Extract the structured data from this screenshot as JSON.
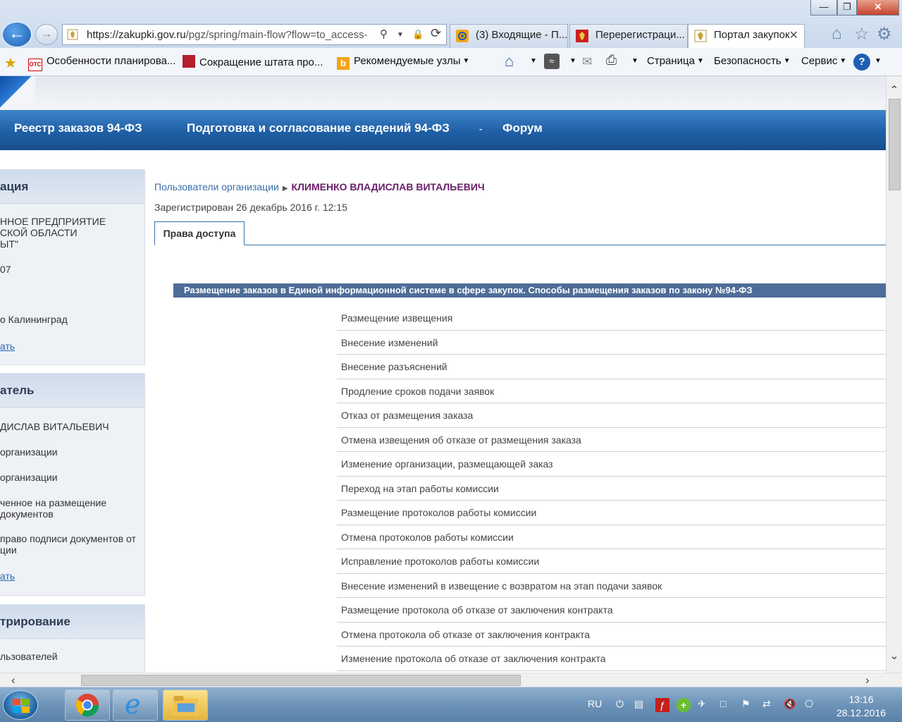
{
  "browser": {
    "window_controls": {
      "minimize": "—",
      "restore": "❐",
      "close": "✕"
    },
    "address": {
      "url_host": "https://zakupki.gov.ru",
      "url_path": "/pgz/spring/main-flow?flow=to_access-",
      "search_glyph": "⚲",
      "lock_glyph": "🔒",
      "refresh_glyph": "⟳"
    },
    "tabs": [
      {
        "label": "(3) Входящие - П...",
        "active": false
      },
      {
        "label": "Перерегистраци...",
        "active": false
      },
      {
        "label": "Портал закупок",
        "active": true
      }
    ],
    "tab_close": "✕",
    "favorites": [
      {
        "label": "Особенности планирова...",
        "badge": "ОТС"
      },
      {
        "label": "Сокращение штата про..."
      },
      {
        "label": "Рекомендуемые узлы"
      }
    ],
    "commands": [
      "Страница",
      "Безопасность",
      "Сервис"
    ],
    "help": "?"
  },
  "site": {
    "nav": [
      "Реестр заказов 94-ФЗ",
      "Подготовка и согласование сведений 94-ФЗ",
      "Форум"
    ],
    "nav_dropdown": "-"
  },
  "sidebar": {
    "org": {
      "title": "ация",
      "lines": [
        "ННОЕ ПРЕДПРИЯТИЕ",
        "СКОЙ ОБЛАСТИ",
        "ЫТ\"",
        "07",
        "о Калининград"
      ],
      "link": "ать"
    },
    "user": {
      "title": "атель",
      "lines": [
        "ДИСЛАВ ВИТАЛЬЕВИЧ",
        "организации",
        "организации",
        "ченное на размещение",
        "документов",
        "право подписи документов от",
        "ции"
      ],
      "link": "ать"
    },
    "admin": {
      "title": "трирование",
      "lines": [
        "льзователей"
      ]
    }
  },
  "main": {
    "breadcrumb_parent": "Пользователи организации",
    "breadcrumb_current": "КЛИМЕНКО ВЛАДИСЛАВ ВИТАЛЬЕВИЧ",
    "registered": "Зарегистрирован 26 декабрь 2016 г. 12:15",
    "tab_label": "Права доступа",
    "section_title": "Размещение заказов в Единой информационной системе в сфере закупок. Способы размещения заказов по закону №94-ФЗ",
    "rights": [
      "Размещение извещения",
      "Внесение изменений",
      "Внесение разъяснений",
      "Продление сроков подачи заявок",
      "Отказ от размещения заказа",
      "Отмена извещения об отказе от размещения заказа",
      "Изменение организации, размещающей заказ",
      "Переход на этап работы комиссии",
      "Размещение протоколов работы комиссии",
      "Отмена протоколов работы комиссии",
      "Исправление протоколов работы комиссии",
      "Внесение изменений в извещение с возвратом на этап подачи заявок",
      "Размещение протокола об отказе от заключения контракта",
      "Отмена протокола об отказе от заключения контракта",
      "Изменение протокола об отказе от заключения контракта"
    ]
  },
  "taskbar": {
    "lang": "RU",
    "time": "13:16",
    "date": "28.12.2016"
  },
  "colors": {
    "nav_blue": "#1f5fa5",
    "section_header": "#4e6d98",
    "breadcrumb_current": "#6a1e6a"
  }
}
